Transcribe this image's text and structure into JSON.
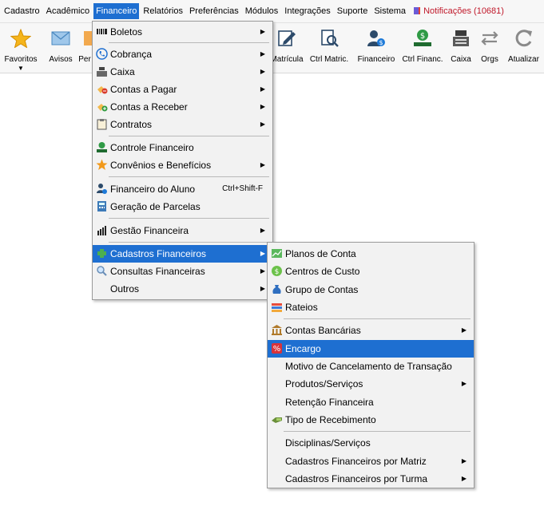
{
  "menubar": {
    "items": [
      {
        "label": "Cadastro",
        "icon": ""
      },
      {
        "label": "Acadêmico",
        "icon": ""
      },
      {
        "label": "Financeiro",
        "icon": ""
      },
      {
        "label": "Relatórios",
        "icon": ""
      },
      {
        "label": "Preferências",
        "icon": ""
      },
      {
        "label": "Módulos",
        "icon": ""
      },
      {
        "label": "Integrações",
        "icon": ""
      },
      {
        "label": "Suporte",
        "icon": ""
      },
      {
        "label": "Sistema",
        "icon": ""
      }
    ],
    "notifications": "Notificações (10681)"
  },
  "toolbar": {
    "favoritos": "Favoritos",
    "avisos": "Avisos",
    "per": "Per",
    "matricula": "Matrícula",
    "ctrl_matric": "Ctrl Matric.",
    "financeiro": "Financeiro",
    "ctrl_financ": "Ctrl Financ.",
    "caixa": "Caixa",
    "orgs": "Orgs",
    "atualizar": "Atualizar"
  },
  "financeiro_menu": {
    "boletos": "Boletos",
    "cobranca": "Cobrança",
    "caixa": "Caixa",
    "contas_pagar": "Contas a Pagar",
    "contas_receber": "Contas a Receber",
    "contratos": "Contratos",
    "controle_financeiro": "Controle Financeiro",
    "convenios": "Convênios e Benefícios",
    "financeiro_aluno": "Financeiro do Aluno",
    "financeiro_aluno_shortcut": "Ctrl+Shift-F",
    "geracao_parcelas": "Geração de Parcelas",
    "gestao_financeira": "Gestão Financeira",
    "cadastros_financeiros": "Cadastros Financeiros",
    "consultas_financeiras": "Consultas Financeiras",
    "outros": "Outros"
  },
  "cadastros_menu": {
    "planos_conta": "Planos de Conta",
    "centros_custo": "Centros de Custo",
    "grupo_contas": "Grupo de Contas",
    "rateios": "Rateios",
    "contas_bancarias": "Contas Bancárias",
    "encargo": "Encargo",
    "motivo_cancelamento": "Motivo de Cancelamento de Transação",
    "produtos_servicos": "Produtos/Serviços",
    "retencao_financeira": "Retenção Financeira",
    "tipo_recebimento": "Tipo de Recebimento",
    "disciplinas_servicos": "Disciplinas/Serviços",
    "por_matriz": "Cadastros Financeiros por Matriz",
    "por_turma": "Cadastros Financeiros por Turma"
  },
  "colors": {
    "highlight": "#1e6fd1",
    "notification": "#c0182a"
  }
}
